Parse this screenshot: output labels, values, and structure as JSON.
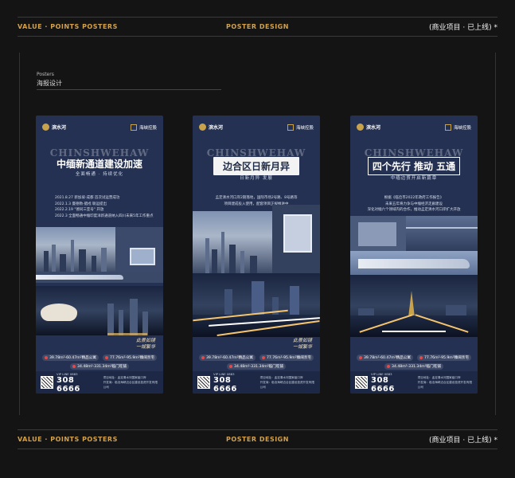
{
  "header": {
    "left": "VALUE · POINTS POSTERS",
    "center": "POSTER DESIGN",
    "right": "(商业项目 · 已上线) *"
  },
  "section": {
    "en": "Posters",
    "cn": "海报设计"
  },
  "footer_bar": {
    "left": "VALUE · POINTS POSTERS",
    "center": "POSTER DESIGN",
    "right": "(商业项目 · 已上线) *"
  },
  "common": {
    "brand_left": "滨水河",
    "brand_right": "海峡控股",
    "en_title": "CHINSHWEHAW",
    "price_a": "39.78m²-60.47m²精品公寓",
    "price_b": "77.76m²-95.9m²臻阔亲宅",
    "price_c": "34.48m²-331.34m²临门旺铺",
    "vip_label": "VIP LINE 0883",
    "phone": "308 6666",
    "addr_1": "项目地址：孟定清水河国家级口岸",
    "addr_2": "开发商：临沧海峡边合区建设投资开发有限公司"
  },
  "posters": [
    {
      "headline": "中缅新通道建设加速",
      "sub": "全面畅通 · 持续优化",
      "news": [
        "2021.8.27 新加坡-成都 首次试运营成功",
        "2022.1.3 曼德勒-腊戍 联运提出",
        "2022.2.19 \"德同三亚号\" 开放",
        "2022.3 全面畅通中缅印度洋新通道纳入四川未来5年工作重点"
      ],
      "signature": [
        "此景如镜",
        "一城繁华"
      ]
    },
    {
      "headline": "边合区日新月异",
      "sub": "日新月异 发展",
      "news": [
        "孟定清水河口岸2期落地，国际市场2号路、8号路等",
        "项目建成投入使用，配套项目正规推进中"
      ],
      "signature": [
        "此景如镜",
        "一城繁华"
      ]
    },
    {
      "headline": "四个先行 推动 五通",
      "sub": "中缅边贸开启新篇章",
      "news": [
        "根据《临沧市2022年政府工作报告》",
        "未来五年将力争与中缅经济走廊建设",
        "深化对缅六个领域内的合作，推动孟定清水河口岸扩大开放"
      ],
      "signature": []
    }
  ]
}
